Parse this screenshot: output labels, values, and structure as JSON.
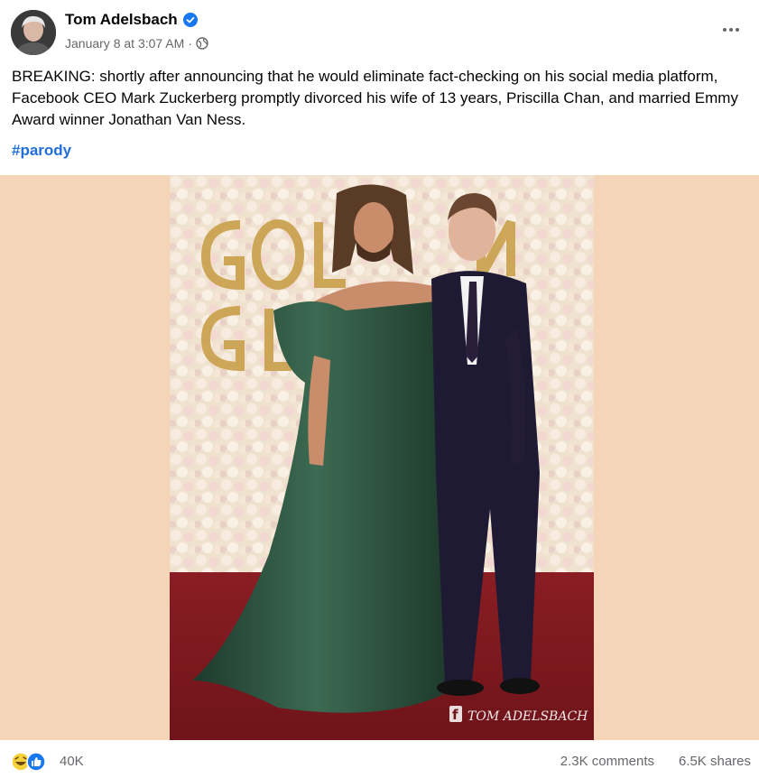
{
  "post": {
    "author": "Tom Adelsbach",
    "timestamp": "January 8 at 3:07 AM",
    "separator": "·",
    "audience_icon": "globe-icon",
    "verified_icon": "verified-badge-icon",
    "more_icon": "more-options-icon",
    "body": "BREAKING: shortly after announcing that he would eliminate fact-checking on his social media platform, Facebook CEO Mark Zuckerberg promptly divorced his wife of 13 years, Priscilla Chan, and married Emmy Award winner Jonathan Van Ness.",
    "hashtag": "#parody"
  },
  "image": {
    "backdrop_text": "GOLDEN GLOBES",
    "watermark": "TOM ADELSBACH",
    "watermark_icon": "facebook-f-icon"
  },
  "footer": {
    "reaction_icons": [
      "laughing-emoji-icon",
      "like-icon"
    ],
    "reaction_count": "40K",
    "comments": "2.3K comments",
    "shares": "6.5K shares"
  },
  "colors": {
    "link": "#216fdb",
    "secondary_text": "#65676b",
    "media_background": "#f5d5b7",
    "verified": "#1877f2"
  }
}
